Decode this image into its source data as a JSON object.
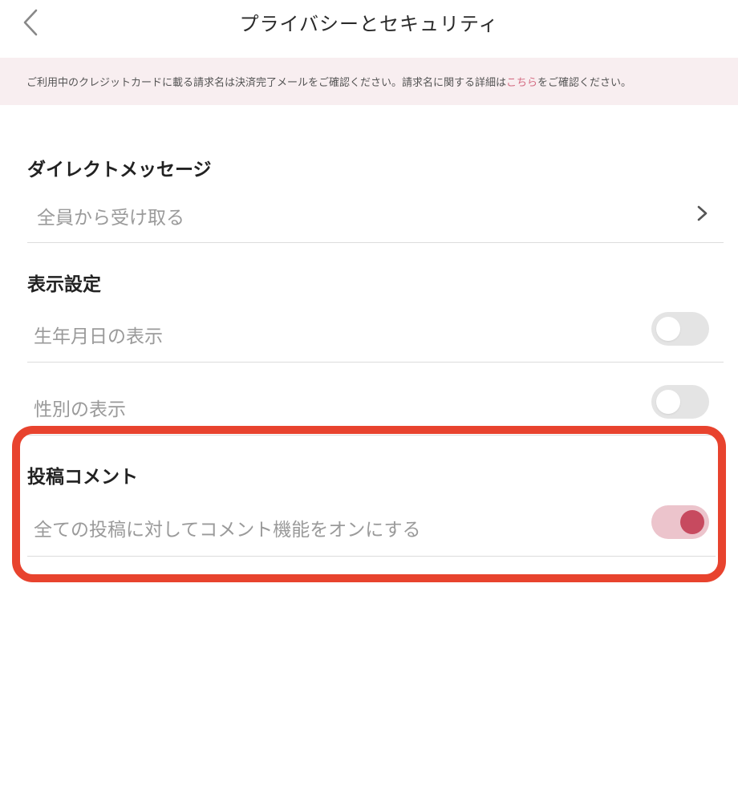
{
  "header": {
    "title": "プライバシーとセキュリティ",
    "back_icon": "chevron-left-icon"
  },
  "notice": {
    "text_before": "ご利用中のクレジットカードに載る請求名は決済完了メールをご確認ください。請求名に関する詳細は",
    "link_text": "こちら",
    "text_after": "をご確認ください。",
    "link_color": "#d46b82",
    "background": "#f8eef0"
  },
  "direct_message": {
    "title": "ダイレクトメッセージ",
    "value": "全員から受け取る",
    "chevron_icon": "chevron-right-icon"
  },
  "display_settings": {
    "title": "表示設定",
    "birthday_label": "生年月日の表示",
    "birthday_enabled": false,
    "gender_label": "性別の表示",
    "gender_enabled": false
  },
  "post_comment": {
    "title": "投稿コメント",
    "comment_label": "全ての投稿に対してコメント機能をオンにする",
    "comment_enabled": true
  },
  "colors": {
    "toggle_on_track": "#ecc4cc",
    "toggle_on_knob": "#c74a5f",
    "toggle_off_track": "#e4e4e4",
    "highlight_border": "#e8432e"
  }
}
